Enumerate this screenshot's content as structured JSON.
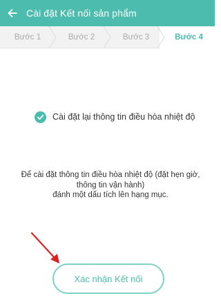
{
  "theme": {
    "accent": "#4cbcae",
    "arrow_color": "#e02020"
  },
  "header": {
    "title": "Cài đặt Kết nối sản phẩm",
    "back_icon": "back-arrow-icon"
  },
  "steps": [
    {
      "label": "Bước 1",
      "active": false
    },
    {
      "label": "Bước 2",
      "active": false
    },
    {
      "label": "Bước 3",
      "active": false
    },
    {
      "label": "Bước 4",
      "active": true
    }
  ],
  "confirm": {
    "label": "Cài đặt lại thông tin điều hòa nhiệt độ",
    "checked": true,
    "icon": "check-circle-icon"
  },
  "instruction": {
    "line1": "Để cài đặt thông tin điều hòa nhiệt độ (đặt hẹn giờ,",
    "line2": "thông tin vận hành)",
    "line3": "đánh một dấu tích lên hạng mục."
  },
  "button": {
    "label": "Xác nhận Kết nối"
  }
}
